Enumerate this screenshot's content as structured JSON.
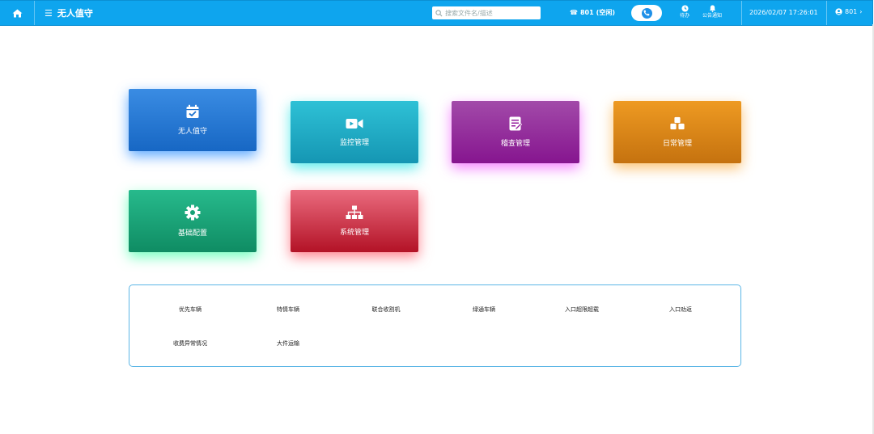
{
  "header": {
    "home_icon": "home-icon",
    "menu_icon": "hamburger-icon",
    "title": "无人值守",
    "search_placeholder": "搜索文件名/描述",
    "extension": "801",
    "extension_status": "(空闲)",
    "pending_label": "待办",
    "notice_label": "公告通知",
    "datetime": "2026/02/07 17:26:01",
    "user": "801",
    "accent_color": "#0ea5ee"
  },
  "tiles": [
    {
      "label": "无人值守",
      "icon": "calendar-check-icon",
      "color": "#1e73d0"
    },
    {
      "label": "监控管理",
      "icon": "video-camera-icon",
      "color": "#1fa9c4"
    },
    {
      "label": "稽查管理",
      "icon": "document-edit-icon",
      "color": "#951e9e"
    },
    {
      "label": "日常管理",
      "icon": "cubes-icon",
      "color": "#dc8418"
    },
    {
      "label": "基础配置",
      "icon": "gear-icon",
      "color": "#17a276"
    },
    {
      "label": "系统管理",
      "icon": "sitemap-icon",
      "color": "#cc2a3e"
    }
  ],
  "quick_links": [
    "优先车辆",
    "特情车辆",
    "联合收割机",
    "绿通车辆",
    "入口超限超载",
    "入口劝返",
    "收费异常情况",
    "大件运输"
  ]
}
